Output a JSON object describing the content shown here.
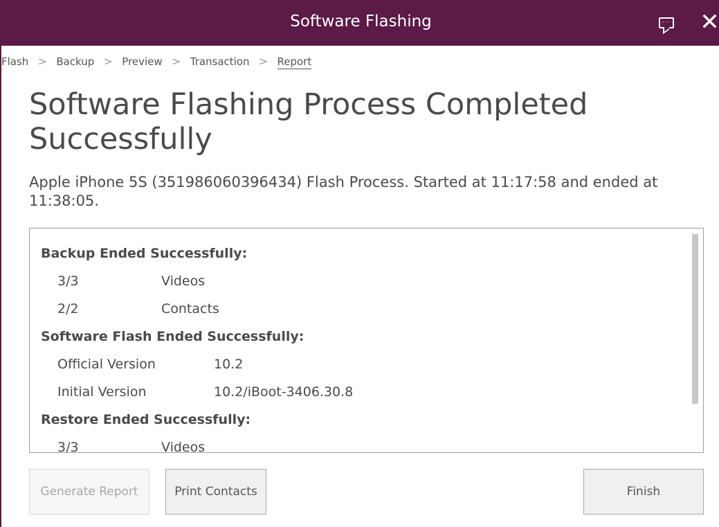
{
  "window": {
    "title": "Software Flashing"
  },
  "breadcrumb": {
    "items": [
      "Flash",
      "Backup",
      "Preview",
      "Transaction",
      "Report"
    ],
    "separator": ">",
    "active": "Report"
  },
  "main": {
    "heading": "Software Flashing Process Completed Successfully",
    "subtitle": "Apple iPhone 5S (351986060396434) Flash Process. Started at 11:17:58 and ended at 11:38:05."
  },
  "report": {
    "backup_title": "Backup Ended Successfully:",
    "backup_rows": [
      {
        "count": "3/3",
        "label": "Videos"
      },
      {
        "count": "2/2",
        "label": "Contacts"
      }
    ],
    "flash_title": "Software Flash Ended Successfully:",
    "flash_rows": [
      {
        "label": "Official Version",
        "value": "10.2"
      },
      {
        "label": "Initial Version",
        "value": "10.2/iBoot-3406.30.8"
      }
    ],
    "restore_title": "Restore Ended Successfully:",
    "restore_rows": [
      {
        "count": "3/3",
        "label": "Videos"
      }
    ]
  },
  "buttons": {
    "generate_report": "Generate Report",
    "generate_report_enabled": false,
    "print_contacts": "Print Contacts",
    "finish": "Finish"
  },
  "colors": {
    "title_bar": "#5c1a47",
    "text": "#4a4a4a"
  },
  "icons": [
    "feedback-icon",
    "close-icon"
  ]
}
